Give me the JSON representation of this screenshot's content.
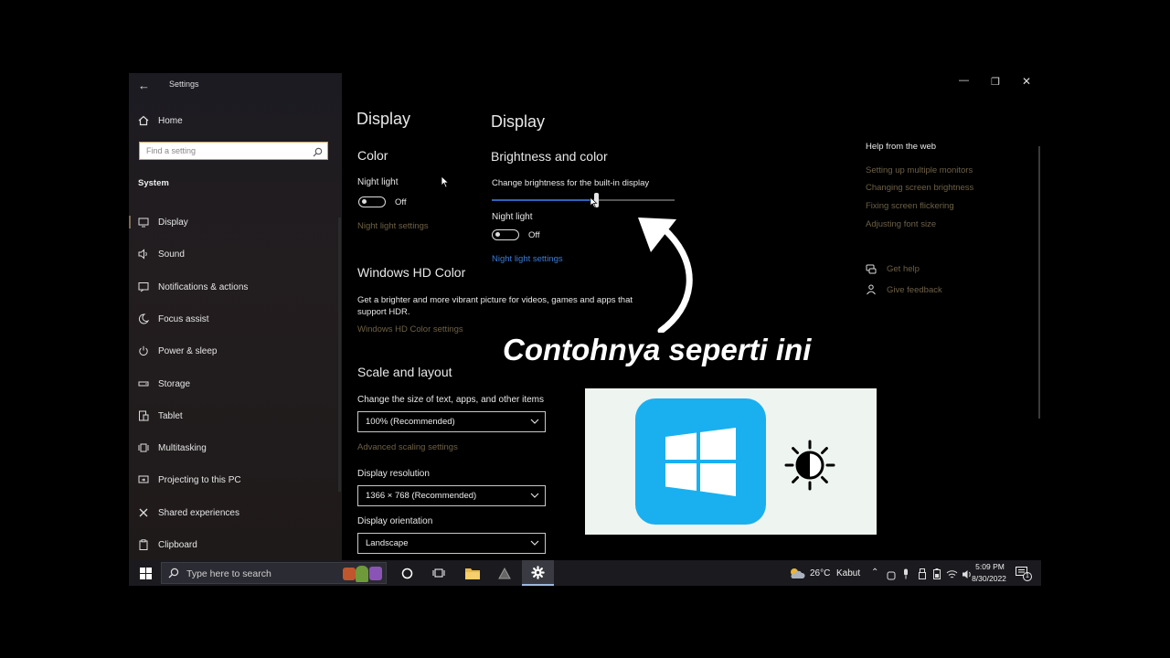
{
  "window": {
    "title": "Settings",
    "controls": {
      "minimize": "—",
      "restore": "❐",
      "close": "✕"
    }
  },
  "sidebar": {
    "home_label": "Home",
    "search_placeholder": "Find a setting",
    "section_title": "System",
    "items": [
      {
        "label": "Display",
        "icon": "monitor-icon"
      },
      {
        "label": "Sound",
        "icon": "speaker-icon"
      },
      {
        "label": "Notifications & actions",
        "icon": "notification-icon"
      },
      {
        "label": "Focus assist",
        "icon": "moon-icon"
      },
      {
        "label": "Power & sleep",
        "icon": "power-icon"
      },
      {
        "label": "Storage",
        "icon": "storage-icon"
      },
      {
        "label": "Tablet",
        "icon": "tablet-icon"
      },
      {
        "label": "Multitasking",
        "icon": "multitasking-icon"
      },
      {
        "label": "Projecting to this PC",
        "icon": "projecting-icon"
      },
      {
        "label": "Shared experiences",
        "icon": "shared-icon"
      },
      {
        "label": "Clipboard",
        "icon": "clipboard-icon"
      }
    ]
  },
  "main": {
    "page_title": "Display",
    "color_heading": "Color",
    "night_light_label": "Night light",
    "night_light_state": "Off",
    "night_light_settings_link": "Night light settings",
    "hd_color_heading": "Windows HD Color",
    "hd_color_desc_line1": "Get a brighter and more vibrant picture for videos, games and apps that",
    "hd_color_desc_line2": "support HDR.",
    "hd_color_link": "Windows HD Color settings",
    "scale_heading": "Scale and layout",
    "scale_label": "Change the size of text, apps, and other items",
    "scale_value": "100% (Recommended)",
    "advanced_scaling_link": "Advanced scaling settings",
    "resolution_label": "Display resolution",
    "resolution_value": "1366 × 768 (Recommended)",
    "orientation_label": "Display orientation",
    "orientation_value": "Landscape"
  },
  "overlay_panel": {
    "page_title": "Display",
    "heading": "Brightness and color",
    "brightness_label": "Change brightness for the built-in display",
    "brightness_level": 0.57,
    "night_light_label": "Night light",
    "night_light_state": "Off",
    "night_light_settings_link": "Night light settings"
  },
  "help": {
    "heading": "Help from the web",
    "links": [
      "Setting up multiple monitors",
      "Changing screen brightness",
      "Fixing screen flickering",
      "Adjusting font size"
    ],
    "get_help": "Get help",
    "give_feedback": "Give feedback"
  },
  "annotation": {
    "caption": "Contohnya seperti ini",
    "card_bg": "#eef4ef",
    "logo_color": "#1ab0ef"
  },
  "taskbar": {
    "search_placeholder": "Type here to search",
    "weather_temp": "26°C",
    "weather_desc": "Kabut",
    "time": "5:09 PM",
    "date": "8/30/2022",
    "notification_count": "1"
  },
  "colors": {
    "accent_link": "#6d6045",
    "blue_link": "#3a7bd5",
    "highlight": "#c9a25f"
  }
}
